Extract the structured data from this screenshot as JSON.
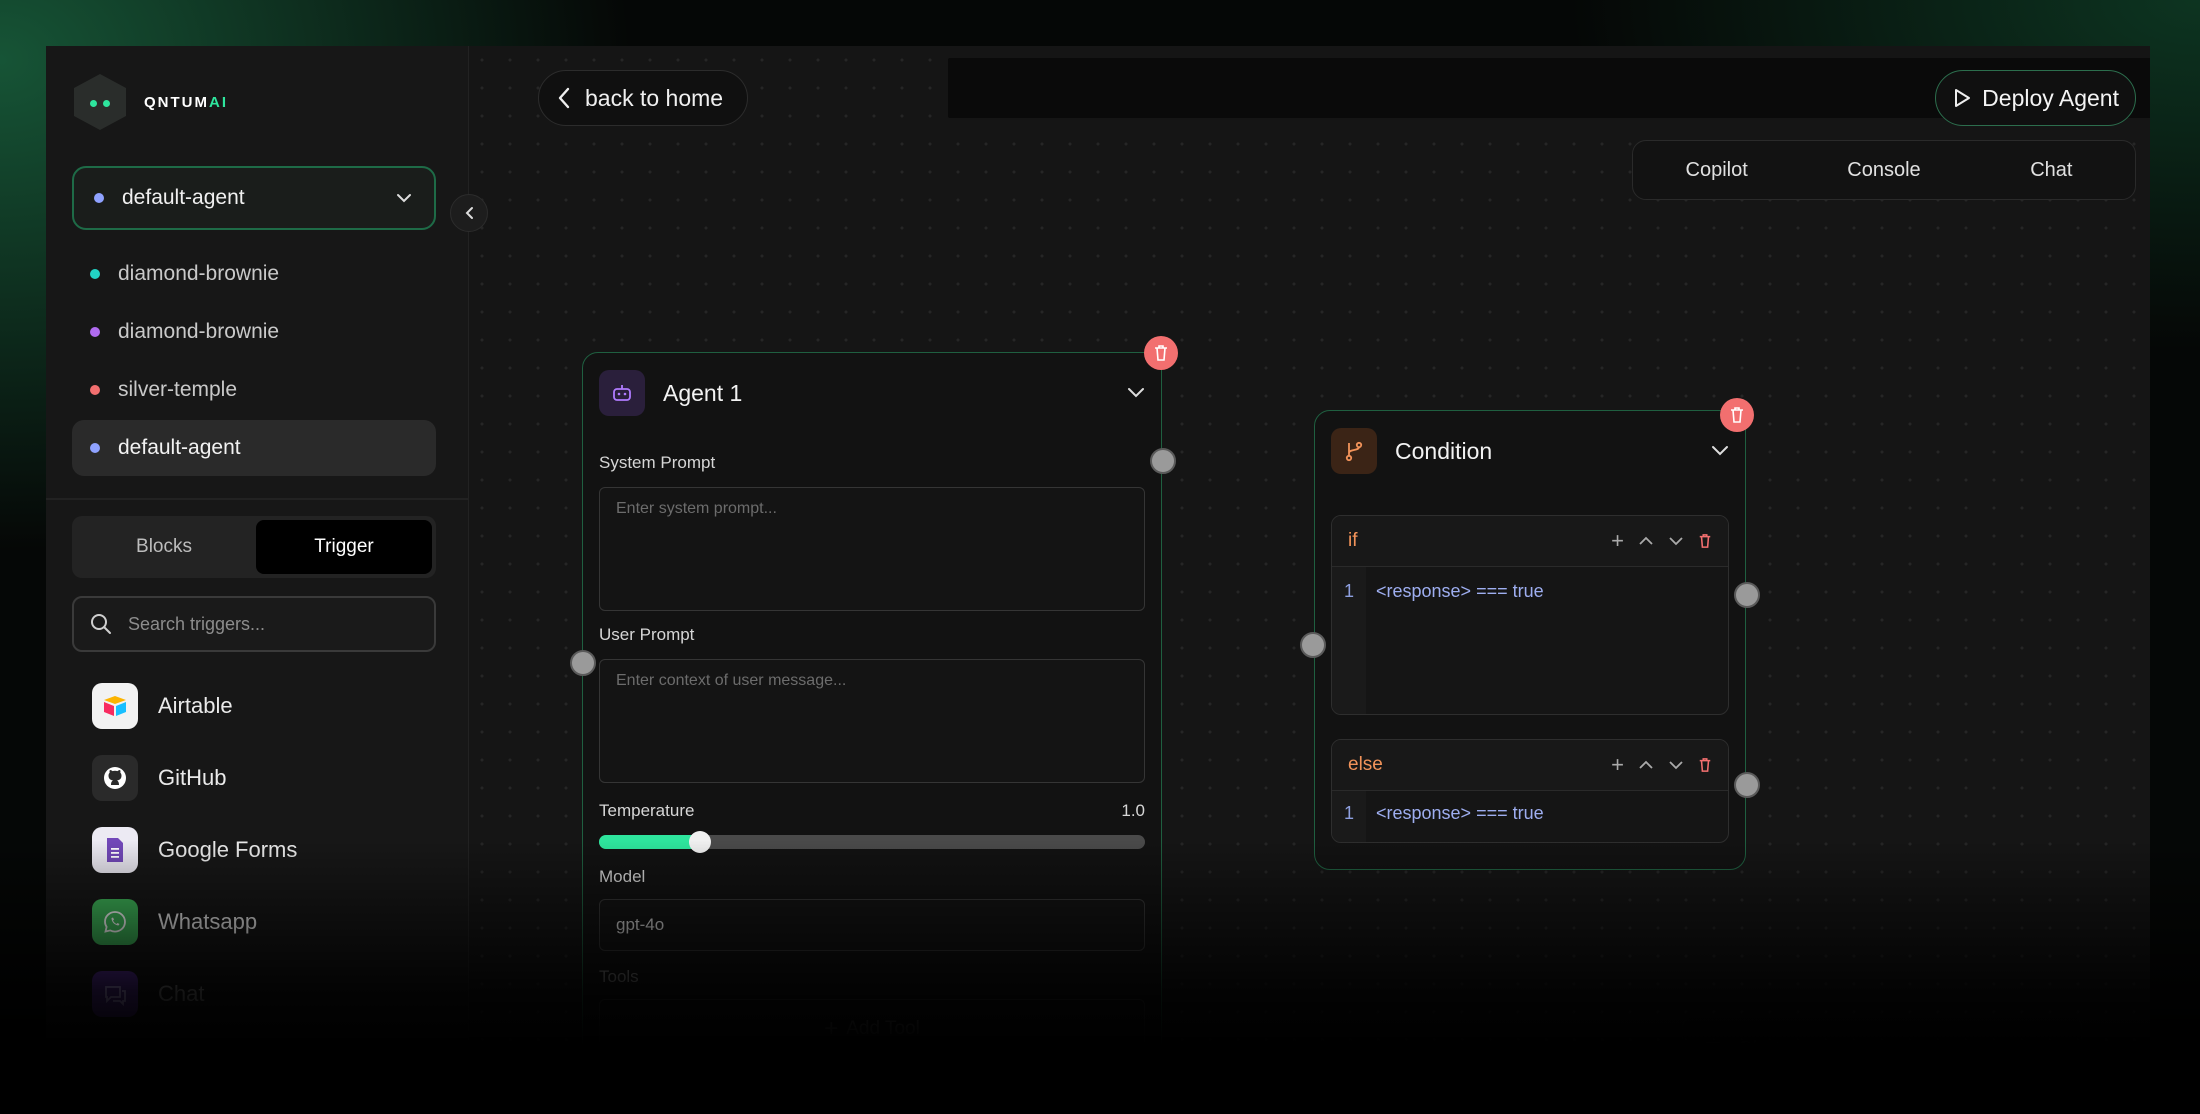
{
  "brand": {
    "name_prefix": "QNTUM",
    "name_suffix": "AI",
    "accent": "#2ee59d"
  },
  "agent_selector": {
    "selected": "default-agent",
    "dot_color": "#8fa2ff"
  },
  "agents": [
    {
      "name": "diamond-brownie",
      "dot_color": "#22d3c5"
    },
    {
      "name": "diamond-brownie",
      "dot_color": "#b06bf0"
    },
    {
      "name": "silver-temple",
      "dot_color": "#f26f6f"
    },
    {
      "name": "default-agent",
      "dot_color": "#8fa2ff",
      "active": true
    }
  ],
  "panel_tabs": {
    "blocks": "Blocks",
    "trigger": "Trigger",
    "active": "trigger"
  },
  "search": {
    "placeholder": "Search triggers..."
  },
  "triggers": [
    {
      "name": "Airtable",
      "icon": "airtable-icon"
    },
    {
      "name": "GitHub",
      "icon": "github-icon"
    },
    {
      "name": "Google Forms",
      "icon": "google-forms-icon"
    },
    {
      "name": "Whatsapp",
      "icon": "whatsapp-icon"
    },
    {
      "name": "Chat",
      "icon": "chat-icon"
    }
  ],
  "header": {
    "back_label": "back to home",
    "deploy_label": "Deploy Agent",
    "tabs": [
      "Copilot",
      "Console",
      "Chat"
    ]
  },
  "agent_node": {
    "title": "Agent 1",
    "system_prompt_label": "System Prompt",
    "system_prompt_placeholder": "Enter system prompt...",
    "user_prompt_label": "User Prompt",
    "user_prompt_placeholder": "Enter context of user message...",
    "temperature_label": "Temperature",
    "temperature_value": "1.0",
    "temperature_fraction": 0.185,
    "model_label": "Model",
    "model_value": "gpt-4o",
    "tools_label": "Tools",
    "add_tool_label": "Add Tool"
  },
  "condition_node": {
    "title": "Condition",
    "if_label": "if",
    "if_line_number": "1",
    "if_code": "<response> === true",
    "else_label": "else",
    "else_line_number": "1",
    "else_code": "<response> === true"
  },
  "faint_node": {
    "label": "Chat"
  }
}
